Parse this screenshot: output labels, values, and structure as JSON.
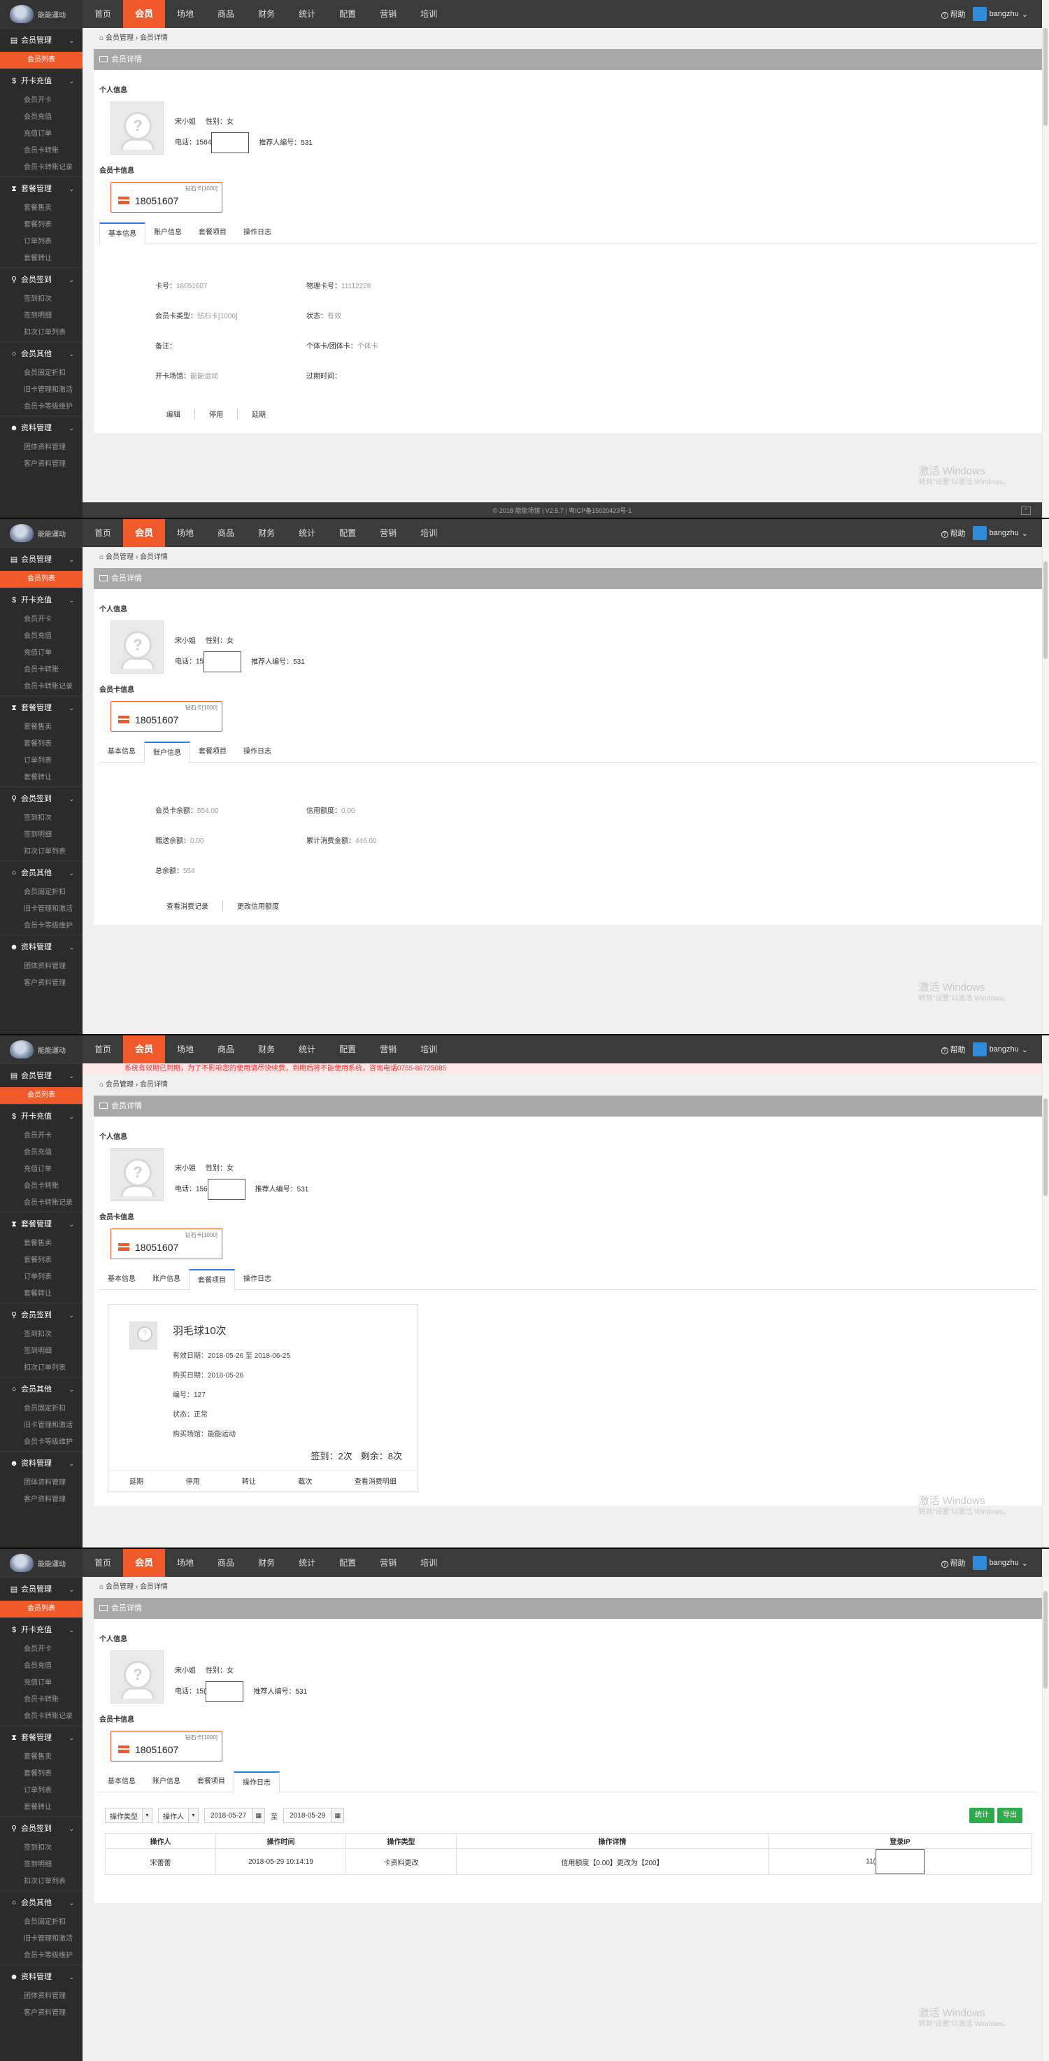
{
  "app": {
    "logo_text": "能能運动"
  },
  "nav": [
    "首页",
    "会员",
    "场地",
    "商品",
    "财务",
    "统计",
    "配置",
    "营销",
    "培训"
  ],
  "nav_active": 1,
  "top_right": {
    "help": "帮助",
    "user": "bangzhu"
  },
  "sidebar": {
    "sections": [
      {
        "icon": "member-card-icon",
        "glyph": "▤",
        "label": "会员管理",
        "items": [
          "会员列表"
        ],
        "active": 0
      },
      {
        "icon": "dollar-icon",
        "glyph": "$",
        "label": "开卡充值",
        "items": [
          "会员开卡",
          "会员充值",
          "充值订单",
          "会员卡转账",
          "会员卡转账记录"
        ]
      },
      {
        "icon": "hourglass-icon",
        "glyph": "⧗",
        "label": "套餐管理",
        "items": [
          "套餐售卖",
          "套餐列表",
          "订单列表",
          "套餐转让"
        ]
      },
      {
        "icon": "map-pin-icon",
        "glyph": "⚲",
        "label": "会员签到",
        "items": [
          "签到扣次",
          "签到明细",
          "扣次订单列表"
        ]
      },
      {
        "icon": "circle-icon",
        "glyph": "○",
        "label": "会员其他",
        "items": [
          "会员固定折扣",
          "旧卡管理和激活",
          "会员卡等级维护"
        ]
      },
      {
        "icon": "users-icon",
        "glyph": "☻",
        "label": "资料管理",
        "items": [
          "团体资料管理",
          "客户资料管理"
        ]
      }
    ]
  },
  "alert": "系统有效期已到期，为了不影响您的使用请尽快续费，到期后将不能使用系统，咨询电话0755-86725085",
  "breadcrumb": [
    "会员管理",
    "会员详情"
  ],
  "panel_title": "会员详情",
  "personal": {
    "section": "个人信息",
    "name": "宋小姐",
    "gender_label": "性别：",
    "gender": "女",
    "phone_label": "电话：",
    "phone_prefix": [
      "1564",
      "15",
      "156",
      "15("
    ],
    "referrer": "推荐人编号：531"
  },
  "card_section": "会员卡信息",
  "card": {
    "type": "钻石卡[1000]",
    "number": "18051607"
  },
  "tabs": [
    "基本信息",
    "账户信息",
    "套餐项目",
    "操作日志"
  ],
  "basic": {
    "fields": [
      {
        "k": "卡号：",
        "v": "18051607"
      },
      {
        "k": "物理卡号：",
        "v": "11112228"
      },
      {
        "k": "会员卡类型：",
        "v": "钻石卡[1000]"
      },
      {
        "k": "状态：",
        "v": "有效"
      },
      {
        "k": "备注：",
        "v": ""
      },
      {
        "k": "个体卡/团体卡：",
        "v": "个体卡"
      },
      {
        "k": "开卡场馆：",
        "v": "能能运动"
      },
      {
        "k": "过期时间：",
        "v": ""
      }
    ],
    "actions": [
      "编辑",
      "停用",
      "延期"
    ]
  },
  "account": {
    "fields": [
      {
        "k": "会员卡余额：",
        "v": "554.00"
      },
      {
        "k": "信用额度：",
        "v": "0.00"
      },
      {
        "k": "赠送余额：",
        "v": "0.00"
      },
      {
        "k": "累计消费金额：",
        "v": "446.00"
      },
      {
        "k": "总余额：",
        "v": "554"
      },
      {
        "k": "",
        "v": ""
      }
    ],
    "actions": [
      "查看消费记录",
      "更改信用额度"
    ]
  },
  "package": {
    "title": "羽毛球10次",
    "valid": "有效日期：2018-05-26 至 2018-06-25",
    "bought": "购买日期：2018-05-26",
    "code": "编号：127",
    "status": "状态：正常",
    "venue": "购买场馆：能能运动",
    "signed": "签到：2次",
    "remain": "剩余：8次",
    "actions": [
      "延期",
      "停用",
      "转让",
      "截次",
      "查看消费明细"
    ]
  },
  "log": {
    "filters": {
      "type": "操作类型",
      "operator": "操作人",
      "from": "2018-05-27",
      "to_sep": "至",
      "to": "2018-05-29"
    },
    "buttons": [
      "统计",
      "导出"
    ],
    "columns": [
      "操作人",
      "操作时间",
      "操作类型",
      "操作详情",
      "登录IP"
    ],
    "rows": [
      [
        "宋蕾蕾",
        "2018-05-29 10:14:19",
        "卡资料更改",
        "信用额度【0.00】更改为【200】",
        "11("
      ]
    ]
  },
  "footer": "© 2018 能能场馆 | V2.5.7 | 粤ICP备15020423号-1",
  "watermark": {
    "line1": "激活 Windows",
    "line2": "转到\"设置\"以激活 Windows。"
  }
}
